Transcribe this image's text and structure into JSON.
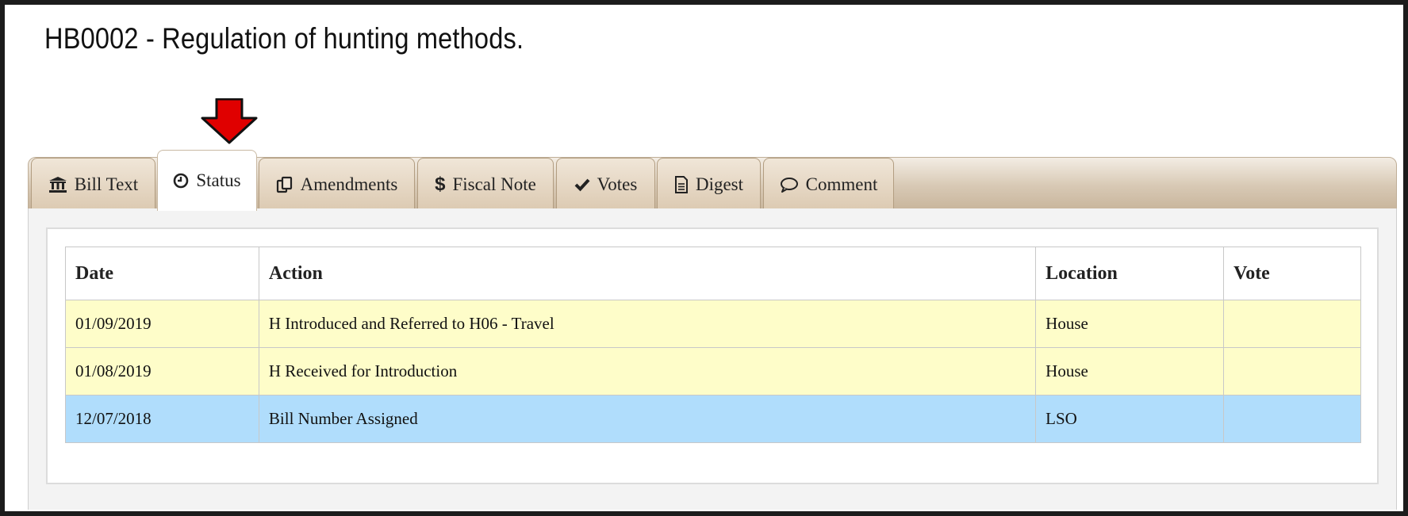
{
  "page_title": "HB0002 - Regulation of hunting methods.",
  "tabs": [
    {
      "label": "Bill Text",
      "icon": "bank-icon",
      "active": false
    },
    {
      "label": "Status",
      "icon": "clock-icon",
      "active": true
    },
    {
      "label": "Amendments",
      "icon": "copy-icon",
      "active": false
    },
    {
      "label": "Fiscal Note",
      "icon": "dollar-icon",
      "active": false
    },
    {
      "label": "Votes",
      "icon": "checkmark-icon",
      "active": false
    },
    {
      "label": "Digest",
      "icon": "document-icon",
      "active": false
    },
    {
      "label": "Comment",
      "icon": "comment-icon",
      "active": false
    }
  ],
  "status_table": {
    "headers": {
      "date": "Date",
      "action": "Action",
      "location": "Location",
      "vote": "Vote"
    },
    "rows": [
      {
        "date": "01/09/2019",
        "action": "H Introduced and Referred to H06 - Travel",
        "location": "House",
        "vote": ""
      },
      {
        "date": "01/08/2019",
        "action": "H Received for Introduction",
        "location": "House",
        "vote": ""
      },
      {
        "date": "12/07/2018",
        "action": "Bill Number Assigned",
        "location": "LSO",
        "vote": ""
      }
    ]
  },
  "colors": {
    "row_highlight_yellow": "#fefdc9",
    "row_highlight_blue": "#b0ddfc",
    "arrow_red": "#e00000",
    "tab_bg": "#dccab2"
  }
}
